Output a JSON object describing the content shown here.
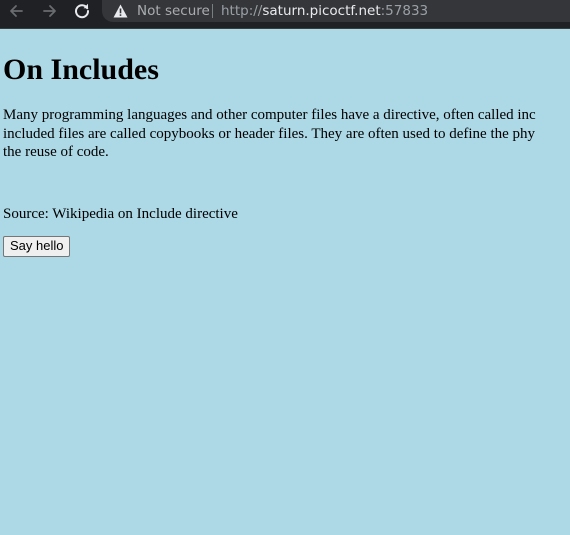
{
  "browser": {
    "back_icon": "arrow-left-icon",
    "forward_icon": "arrow-right-icon",
    "reload_icon": "reload-icon",
    "security_icon": "warning-triangle-icon",
    "security_label": "Not secure",
    "url_scheme": "http://",
    "url_host": "saturn.picoctf.net",
    "url_port": ":57833"
  },
  "page": {
    "background": "#add8e6",
    "title": "On Includes",
    "paragraph_lines": [
      "Many programming languages and other computer files have a directive, often called inc",
      "included files are called copybooks or header files. They are often used to define the phy",
      "the reuse of code."
    ],
    "source": "Source: Wikipedia on Include directive",
    "button_label": "Say hello"
  }
}
